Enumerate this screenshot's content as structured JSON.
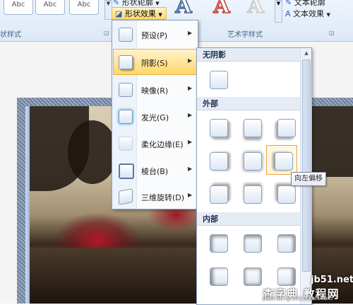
{
  "ribbon": {
    "style_thumbs": [
      "Abc",
      "Abc",
      "Abc"
    ],
    "shape_outline_label": "形状轮廓",
    "shape_effect_label": "形状效果",
    "group_shape_styles": "状样式",
    "wordart_letters": [
      "A",
      "A",
      "A"
    ],
    "text_outline_label": "文本轮廓",
    "text_effect_label": "文本效果",
    "group_wordart_styles": "艺术字样式"
  },
  "menu": {
    "items": [
      {
        "label": "预设(P)",
        "icon": "preset-icon"
      },
      {
        "label": "阴影(S)",
        "icon": "shadow-icon"
      },
      {
        "label": "映像(R)",
        "icon": "reflection-icon"
      },
      {
        "label": "发光(G)",
        "icon": "glow-icon"
      },
      {
        "label": "柔化边缘(E)",
        "icon": "soft-edges-icon"
      },
      {
        "label": "棱台(B)",
        "icon": "bevel-icon"
      },
      {
        "label": "三维旋转(D)",
        "icon": "3d-rotation-icon"
      }
    ],
    "active_index": 1
  },
  "gallery": {
    "sections": [
      {
        "title": "无阴影",
        "cells": 1
      },
      {
        "title": "外部",
        "cells": 9
      },
      {
        "title": "内部",
        "cells": 6
      }
    ],
    "hover_tooltip": "向左偏移"
  },
  "watermark": {
    "line1": "jb51.net",
    "line2": "查字典 教程网",
    "line3": "jiaocheng.chazidian.com"
  },
  "colors": {
    "accent_highlight": "#ffd66a",
    "menu_border": "#8da4c4",
    "ribbon_bg": "#dce8f7"
  }
}
